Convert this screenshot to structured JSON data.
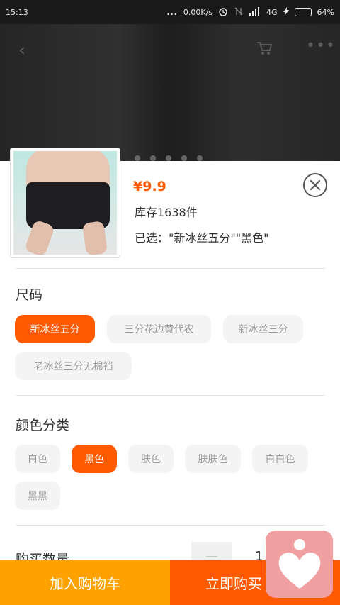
{
  "status_bar": {
    "time": "15:13",
    "dots": "...",
    "speed": "0.00K/s",
    "network": "4G",
    "battery": "64%",
    "battery_level": 0.64
  },
  "background": {
    "back_icon": "chevron-left-icon",
    "cart_icon": "cart-icon",
    "more_icon": "more-icon"
  },
  "product": {
    "price": "¥9.9",
    "stock": "库存1638件",
    "selected": "已选：\"新冰丝五分\"\"黑色\""
  },
  "size_section": {
    "title": "尺码",
    "options": [
      {
        "label": "新冰丝五分",
        "selected": true
      },
      {
        "label": "三分花边黄代农",
        "selected": false
      },
      {
        "label": "新冰丝三分",
        "selected": false
      },
      {
        "label": "老冰丝三分无棉裆",
        "selected": false
      }
    ]
  },
  "color_section": {
    "title": "颜色分类",
    "options": [
      {
        "label": "白色",
        "selected": false
      },
      {
        "label": "黑色",
        "selected": true
      },
      {
        "label": "肤色",
        "selected": false
      },
      {
        "label": "肤肤色",
        "selected": false
      },
      {
        "label": "白白色",
        "selected": false
      },
      {
        "label": "黑黑",
        "selected": false
      }
    ]
  },
  "quantity_section": {
    "title": "购买数量",
    "minus": "—",
    "value": "1"
  },
  "actions": {
    "add_to_cart": "加入购物车",
    "buy_now": "立即购买"
  },
  "colors": {
    "accent": "#ff5a00",
    "cart_button": "#ffa200",
    "widget": "#f0a0a0"
  }
}
